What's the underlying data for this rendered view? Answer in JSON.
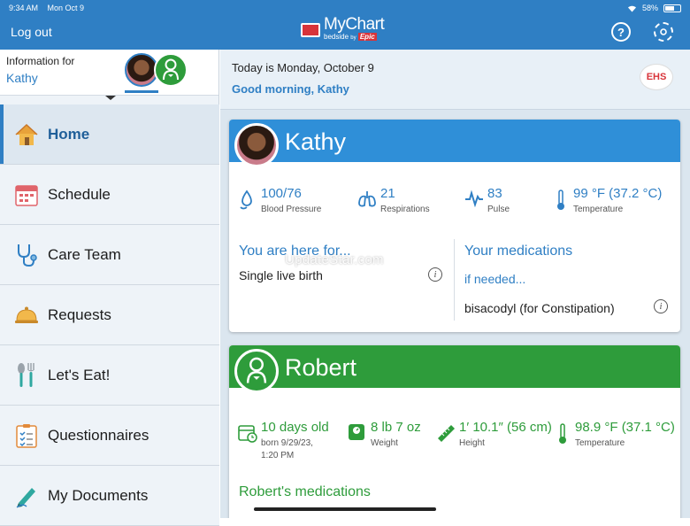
{
  "status_bar": {
    "time": "9:34 AM",
    "date": "Mon Oct 9",
    "battery": "58%",
    "battery_fraction": 0.58
  },
  "header": {
    "logout_label": "Log out",
    "logo_title": "MyChart",
    "logo_sub": "bedside",
    "logo_by": "by",
    "logo_brand": "Epic",
    "help_icon": "help-icon",
    "settings_icon": "gear-icon"
  },
  "sidebar": {
    "info_label": "Information for",
    "patient_name": "Kathy",
    "items": [
      {
        "label": "Home",
        "icon": "home-icon",
        "active": true
      },
      {
        "label": "Schedule",
        "icon": "calendar-icon"
      },
      {
        "label": "Care Team",
        "icon": "stethoscope-icon"
      },
      {
        "label": "Requests",
        "icon": "bell-icon"
      },
      {
        "label": "Let's Eat!",
        "icon": "utensils-icon"
      },
      {
        "label": "Questionnaires",
        "icon": "checklist-icon"
      },
      {
        "label": "My Documents",
        "icon": "pen-icon"
      }
    ]
  },
  "greeting": {
    "date_text": "Today is Monday, October 9",
    "message": "Good morning, Kathy",
    "org_logo": "EHS"
  },
  "mother_card": {
    "name": "Kathy",
    "vitals": [
      {
        "value": "100/76",
        "label": "Blood Pressure",
        "icon": "blood-pressure-icon"
      },
      {
        "value": "21",
        "label": "Respirations",
        "icon": "lungs-icon"
      },
      {
        "value": "83",
        "label": "Pulse",
        "icon": "pulse-icon"
      },
      {
        "value": "99 °F (37.2 °C)",
        "label": "Temperature",
        "icon": "thermometer-icon"
      }
    ],
    "reason_title": "You are here for...",
    "reason_value": "Single live birth",
    "meds_title": "Your medications",
    "meds_sub": "if needed...",
    "meds_item": "bisacodyl (for Constipation)"
  },
  "baby_card": {
    "name": "Robert",
    "stats": [
      {
        "value": "10 days old",
        "label": "born 9/29/23,",
        "label2": "1:20 PM",
        "icon": "calendar-clock-icon"
      },
      {
        "value": "8 lb 7 oz",
        "label": "Weight",
        "icon": "scale-icon"
      },
      {
        "value": "1′ 10.1″ (56 cm)",
        "label": "Height",
        "icon": "ruler-icon"
      },
      {
        "value": "98.9 °F (37.1 °C)",
        "label": "Temperature",
        "icon": "thermometer-icon"
      }
    ],
    "meds_title": "Robert's medications"
  },
  "watermark": "UpdateStar.com",
  "colors": {
    "brand_blue": "#2f7fc4",
    "baby_green": "#2e9c3b",
    "logo_red": "#d8343a"
  }
}
